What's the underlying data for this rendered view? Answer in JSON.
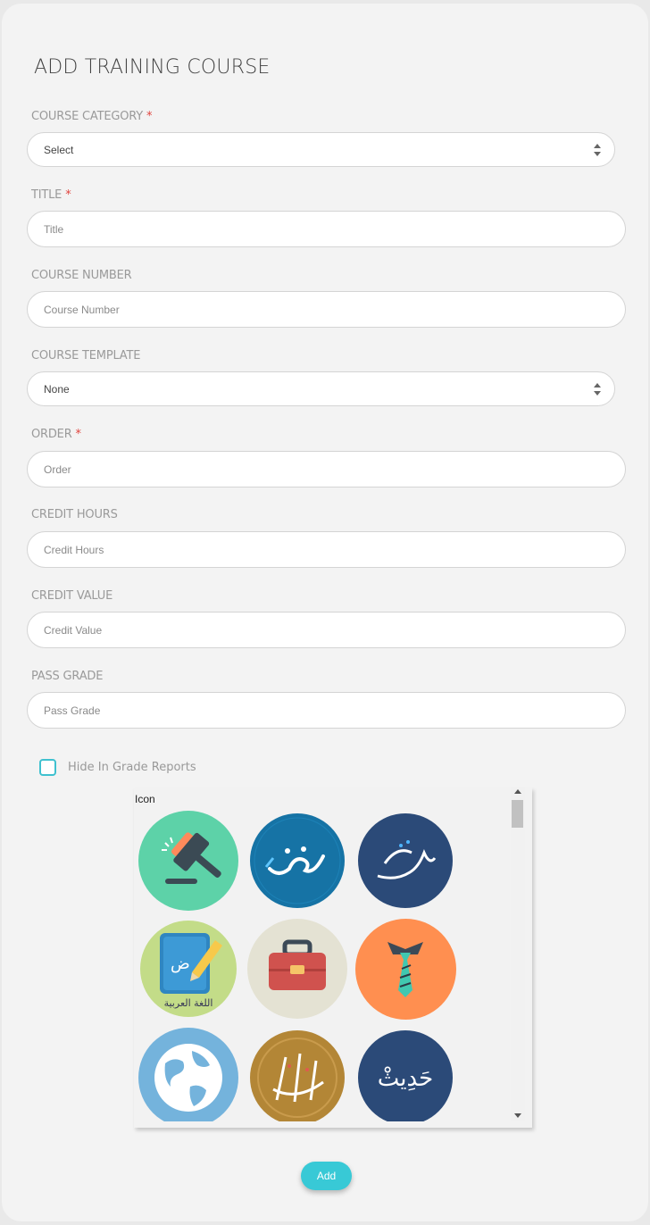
{
  "form": {
    "title": "ADD TRAINING COURSE",
    "required_mark": "*",
    "course_category": {
      "label": "COURSE CATEGORY",
      "value": "Select"
    },
    "title_field": {
      "label": "TITLE",
      "placeholder": "Title"
    },
    "course_number": {
      "label": "COURSE NUMBER",
      "placeholder": "Course Number"
    },
    "course_template": {
      "label": "COURSE TEMPLATE",
      "value": "None"
    },
    "order": {
      "label": "ORDER",
      "placeholder": "Order"
    },
    "credit_hours": {
      "label": "CREDIT HOURS",
      "placeholder": "Credit Hours"
    },
    "credit_value": {
      "label": "CREDIT VALUE",
      "placeholder": "Credit Value"
    },
    "pass_grade": {
      "label": "PASS GRADE",
      "placeholder": "Pass Grade"
    },
    "hide_in_grade_reports": {
      "label": "Hide In Grade Reports",
      "checked": false
    },
    "icon_picker": {
      "label": "Icon",
      "icons": [
        "gavel-icon",
        "fiqh-calligraphy-icon",
        "hadith-calligraphy-icon",
        "arabic-language-book-icon",
        "briefcase-icon",
        "necktie-icon",
        "globe-icon",
        "quran-calligraphy-icon",
        "hadith-text-icon"
      ],
      "text_in_icons": {
        "arabic_language": "اللغة العربية",
        "dad_letter": "ض",
        "hadith": "حَدِيثْ"
      }
    },
    "add_button": "Add"
  },
  "colors": {
    "accent": "#38c9d6",
    "required": "#e0443e"
  }
}
